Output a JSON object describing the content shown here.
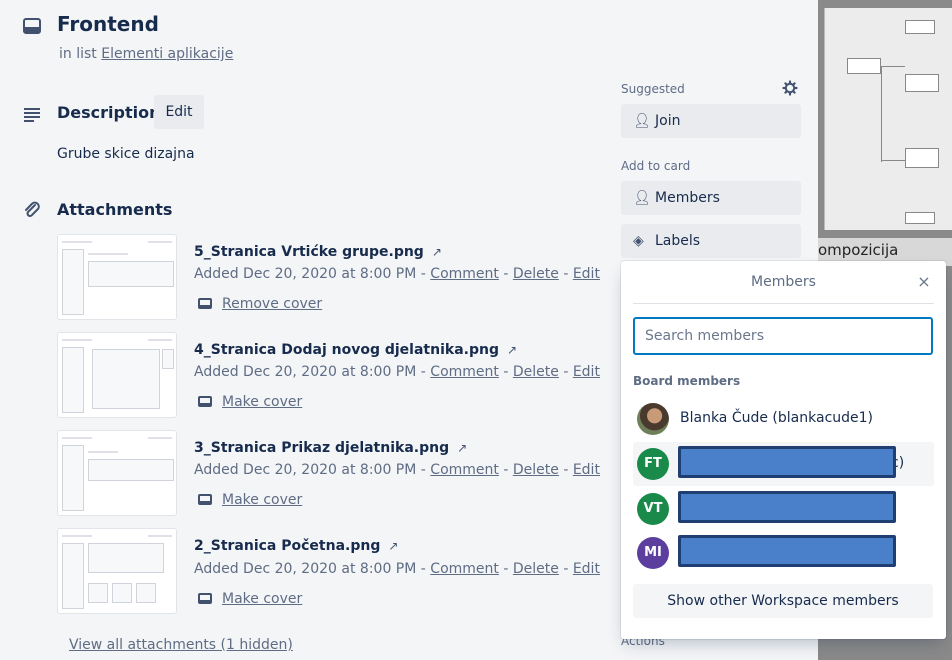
{
  "card": {
    "title": "Frontend",
    "in_list_prefix": "in list",
    "list_name": "Elementi aplikacije"
  },
  "description": {
    "heading": "Description",
    "edit_label": "Edit",
    "text": "Grube skice dizajna"
  },
  "attachments": {
    "heading": "Attachments",
    "items": [
      {
        "name": "5_Stranica Vrtićke grupe.png",
        "added": "Added Dec 20, 2020 at 8:00 PM",
        "cover_label": "Remove cover"
      },
      {
        "name": "4_Stranica Dodaj novog djelatnika.png",
        "added": "Added Dec 20, 2020 at 8:00 PM",
        "cover_label": "Make cover"
      },
      {
        "name": "3_Stranica Prikaz djelatnika.png",
        "added": "Added Dec 20, 2020 at 8:00 PM",
        "cover_label": "Make cover"
      },
      {
        "name": "2_Stranica Početna.png",
        "added": "Added Dec 20, 2020 at 8:00 PM",
        "cover_label": "Make cover"
      }
    ],
    "link_comment": "Comment",
    "link_delete": "Delete",
    "link_edit": "Edit",
    "sep": "-",
    "ext_arrow": "↗",
    "view_all": "View all attachments (1 hidden)"
  },
  "sidebar": {
    "suggested_label": "Suggested",
    "join_label": "Join",
    "add_to_card_label": "Add to card",
    "members_label": "Members",
    "labels_label": "Labels",
    "actions_label": "Actions"
  },
  "background": {
    "caption": "ompozicija"
  },
  "members_popover": {
    "title": "Members",
    "close_glyph": "×",
    "search_placeholder": "Search members",
    "board_members_label": "Board members",
    "members": [
      {
        "display": "Blanka Čude (blankacude1)",
        "initials": "",
        "avatar_color": ""
      },
      {
        "display": "c)",
        "initials": "FT",
        "avatar_color": "#1a8a4a"
      },
      {
        "display": "",
        "initials": "VT",
        "avatar_color": "#1a8a4a"
      },
      {
        "display": "",
        "initials": "MI",
        "avatar_color": "#5b3e9e"
      }
    ],
    "show_other_label": "Show other Workspace members"
  }
}
